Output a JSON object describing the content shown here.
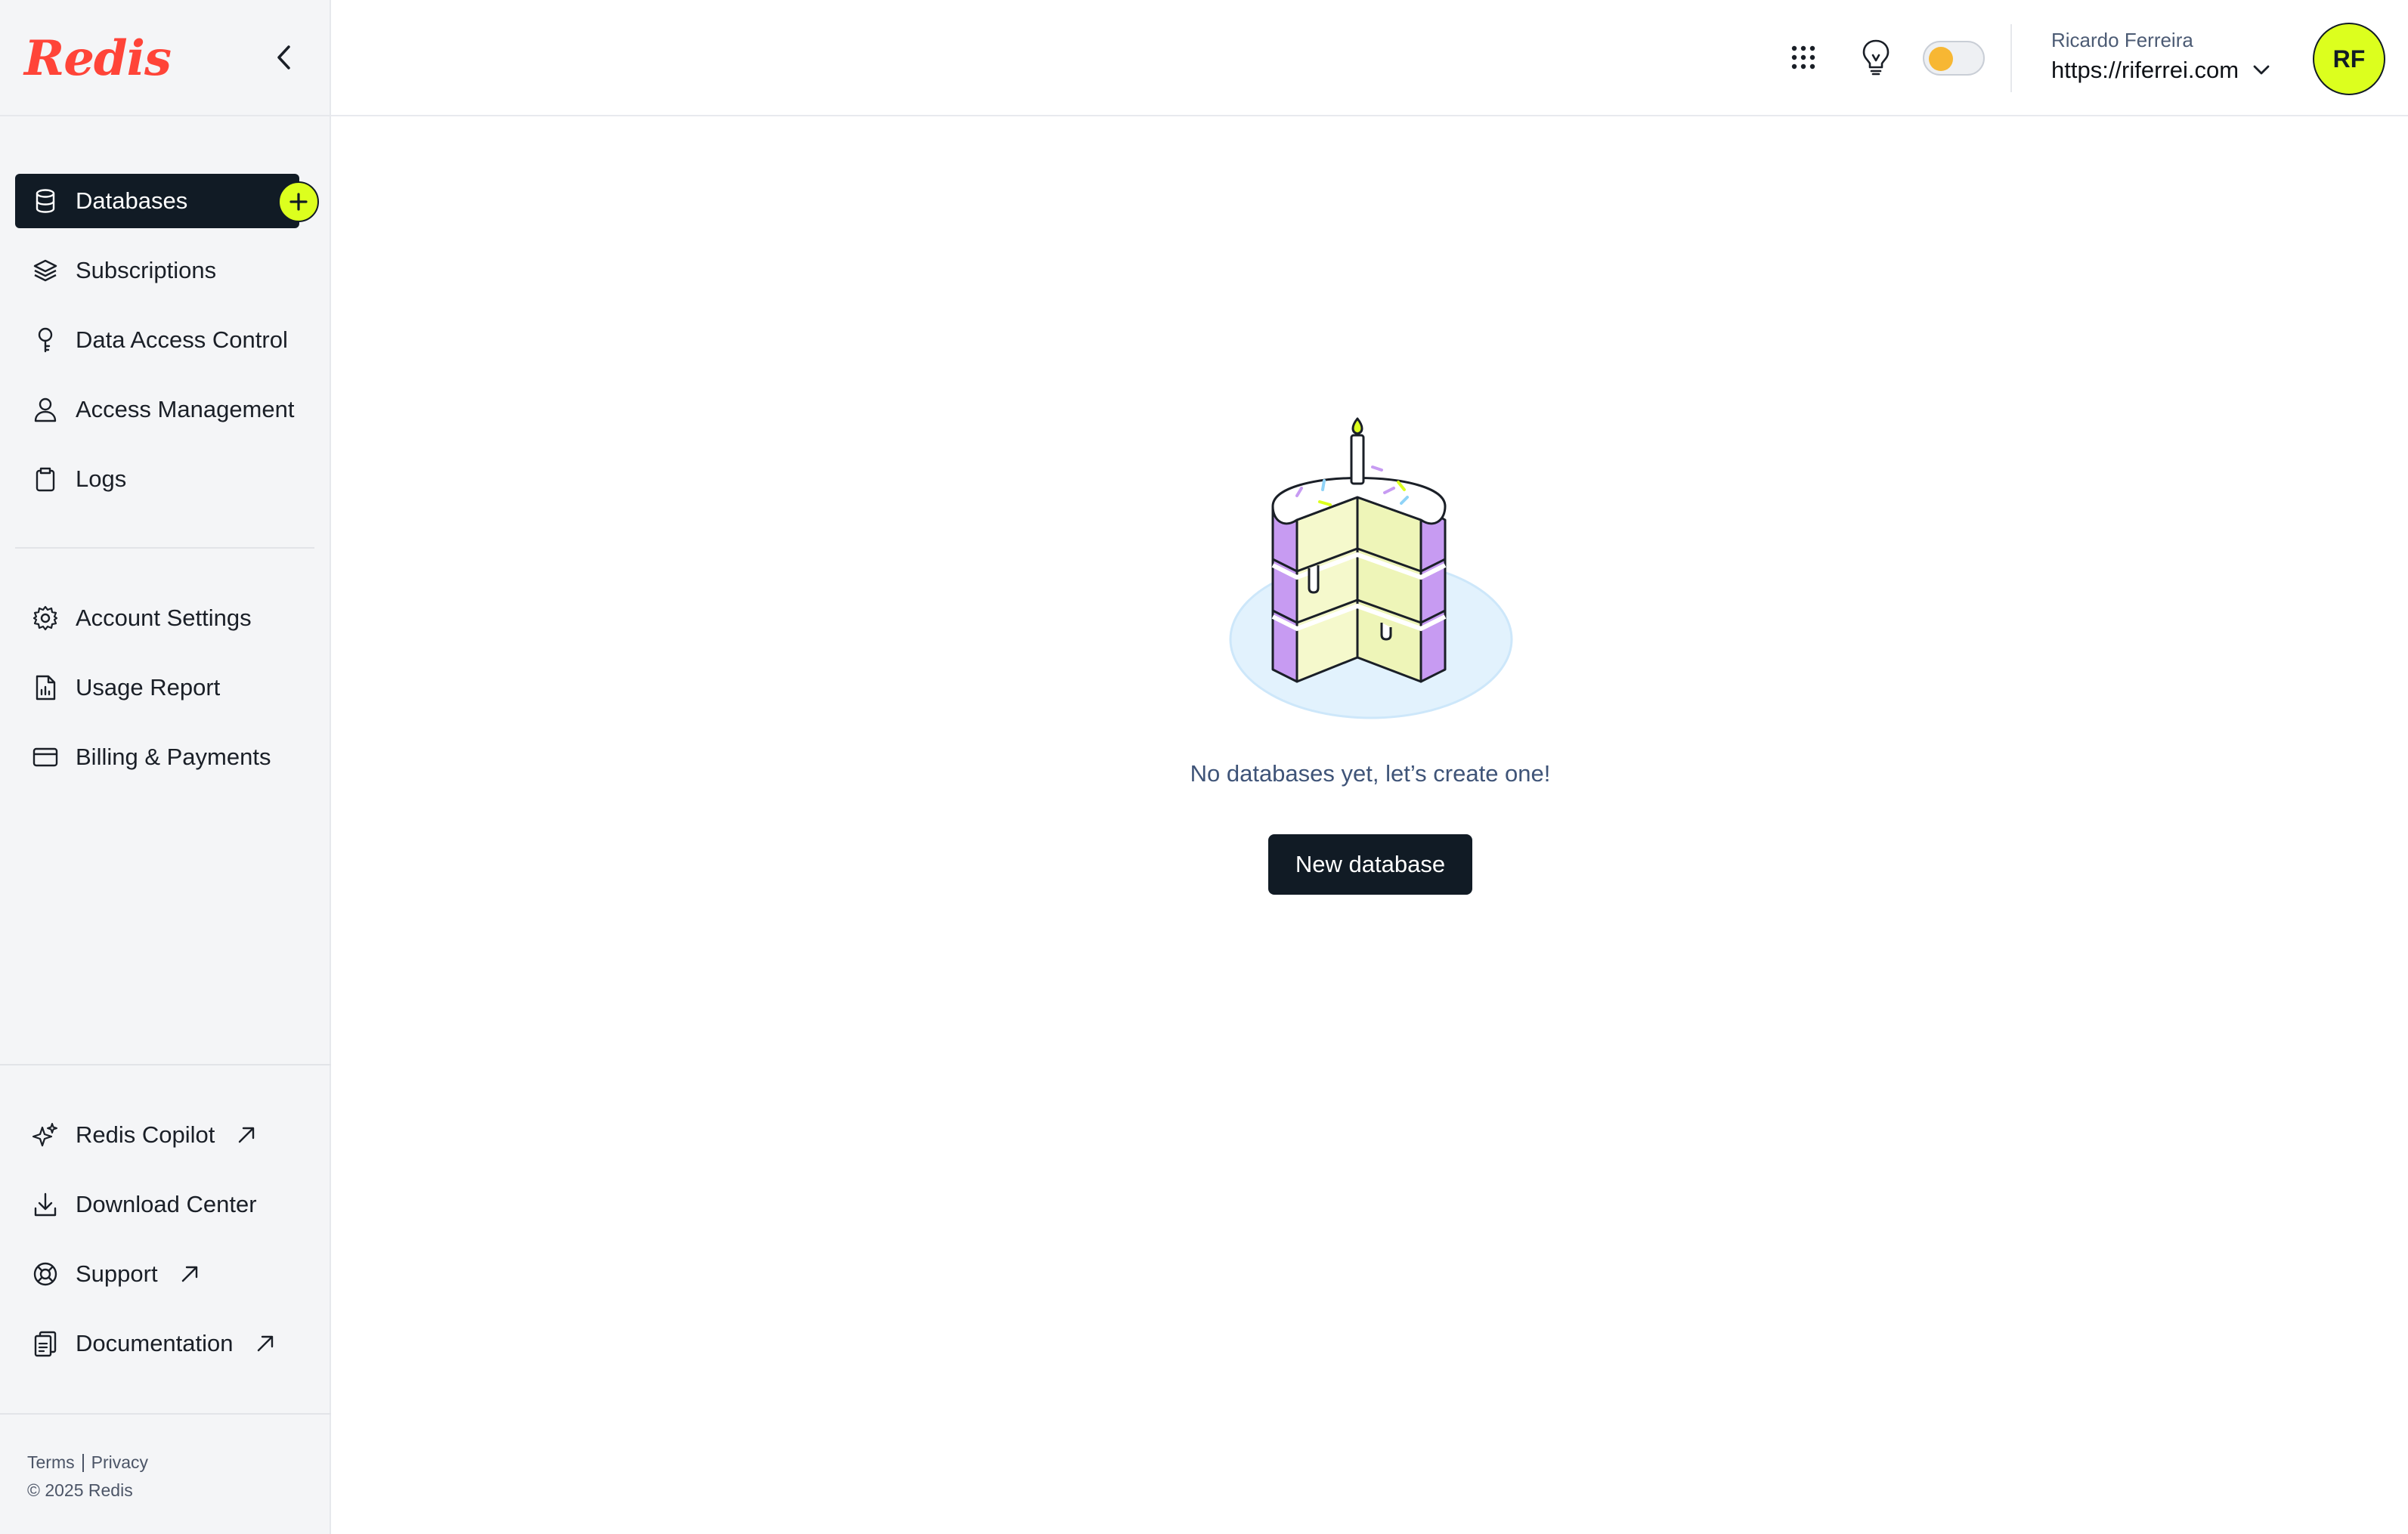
{
  "brand": {
    "logo_text": "Redis",
    "logo_color": "#ff4438"
  },
  "sidebar": {
    "items": [
      {
        "label": "Databases",
        "icon": "database-icon",
        "active": true
      },
      {
        "label": "Subscriptions",
        "icon": "layers-icon"
      },
      {
        "label": "Data Access Control",
        "icon": "key-icon"
      },
      {
        "label": "Access Management",
        "icon": "user-icon"
      },
      {
        "label": "Logs",
        "icon": "clipboard-icon"
      }
    ],
    "settings_items": [
      {
        "label": "Account Settings",
        "icon": "gear-icon"
      },
      {
        "label": "Usage Report",
        "icon": "report-icon"
      },
      {
        "label": "Billing & Payments",
        "icon": "credit-card-icon"
      }
    ],
    "bottom_items": [
      {
        "label": "Redis Copilot",
        "icon": "sparkle-icon",
        "external": true
      },
      {
        "label": "Download Center",
        "icon": "download-icon",
        "external": false
      },
      {
        "label": "Support",
        "icon": "lifebuoy-icon",
        "external": true
      },
      {
        "label": "Documentation",
        "icon": "document-icon",
        "external": true
      }
    ],
    "footer": {
      "terms": "Terms",
      "privacy": "Privacy",
      "copyright": "© 2025 Redis"
    }
  },
  "header": {
    "user_name": "Ricardo Ferreira",
    "account_url": "https://riferrei.com",
    "avatar_initials": "RF",
    "avatar_color": "#dcff1e",
    "icons": [
      "apps-grid-icon",
      "lightbulb-icon",
      "theme-toggle"
    ]
  },
  "main": {
    "empty_message": "No databases yet, let’s create one!",
    "cta_label": "New database",
    "illustration": "birthday-cake-illustration"
  }
}
